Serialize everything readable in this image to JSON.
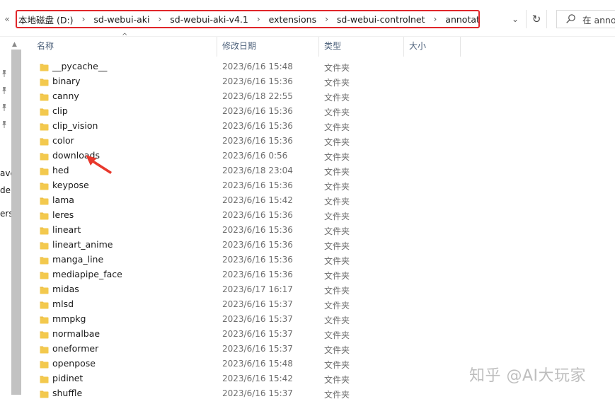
{
  "address_bar": {
    "back_chevron": "«",
    "crumbs": [
      "本地磁盘 (D:)",
      "sd-webui-aki",
      "sd-webui-aki-v4.1",
      "extensions",
      "sd-webui-controlnet",
      "annotator"
    ],
    "separator": "›",
    "dropdown": "⌄",
    "refresh": "↻",
    "search_text": "在 annot",
    "highlight_color": "#e0262a"
  },
  "nav_pane": {
    "fragments": [
      "ave",
      "de",
      "ersi"
    ]
  },
  "columns": {
    "name": "名称",
    "date_modified": "修改日期",
    "type": "类型",
    "size": "大小"
  },
  "files": [
    {
      "name": "__pycache__",
      "date": "2023/6/16 15:48",
      "type": "文件夹"
    },
    {
      "name": "binary",
      "date": "2023/6/16 15:36",
      "type": "文件夹"
    },
    {
      "name": "canny",
      "date": "2023/6/18 22:55",
      "type": "文件夹"
    },
    {
      "name": "clip",
      "date": "2023/6/16 15:36",
      "type": "文件夹"
    },
    {
      "name": "clip_vision",
      "date": "2023/6/16 15:36",
      "type": "文件夹"
    },
    {
      "name": "color",
      "date": "2023/6/16 15:36",
      "type": "文件夹"
    },
    {
      "name": "downloads",
      "date": "2023/6/16 0:56",
      "type": "文件夹"
    },
    {
      "name": "hed",
      "date": "2023/6/18 23:04",
      "type": "文件夹"
    },
    {
      "name": "keypose",
      "date": "2023/6/16 15:36",
      "type": "文件夹"
    },
    {
      "name": "lama",
      "date": "2023/6/16 15:42",
      "type": "文件夹"
    },
    {
      "name": "leres",
      "date": "2023/6/16 15:36",
      "type": "文件夹"
    },
    {
      "name": "lineart",
      "date": "2023/6/16 15:36",
      "type": "文件夹"
    },
    {
      "name": "lineart_anime",
      "date": "2023/6/16 15:36",
      "type": "文件夹"
    },
    {
      "name": "manga_line",
      "date": "2023/6/16 15:36",
      "type": "文件夹"
    },
    {
      "name": "mediapipe_face",
      "date": "2023/6/16 15:36",
      "type": "文件夹"
    },
    {
      "name": "midas",
      "date": "2023/6/17 16:17",
      "type": "文件夹"
    },
    {
      "name": "mlsd",
      "date": "2023/6/16 15:37",
      "type": "文件夹"
    },
    {
      "name": "mmpkg",
      "date": "2023/6/16 15:37",
      "type": "文件夹"
    },
    {
      "name": "normalbae",
      "date": "2023/6/16 15:37",
      "type": "文件夹"
    },
    {
      "name": "oneformer",
      "date": "2023/6/16 15:37",
      "type": "文件夹"
    },
    {
      "name": "openpose",
      "date": "2023/6/16 15:48",
      "type": "文件夹"
    },
    {
      "name": "pidinet",
      "date": "2023/6/16 15:42",
      "type": "文件夹"
    },
    {
      "name": "shuffle",
      "date": "2023/6/16 15:37",
      "type": "文件夹"
    }
  ],
  "annotation": {
    "target": "downloads",
    "arrow_color": "#e8382c"
  },
  "watermark": "知乎 @AI大玩家",
  "icons": {
    "folder": "folder-icon",
    "pin": "pin-icon",
    "search": "search-icon",
    "refresh": "refresh-icon"
  },
  "colors": {
    "folder_fill": "#f3c94e",
    "folder_tab": "#e9b53a",
    "header_text": "#4c607a",
    "meta_text": "#6d6d6d"
  }
}
